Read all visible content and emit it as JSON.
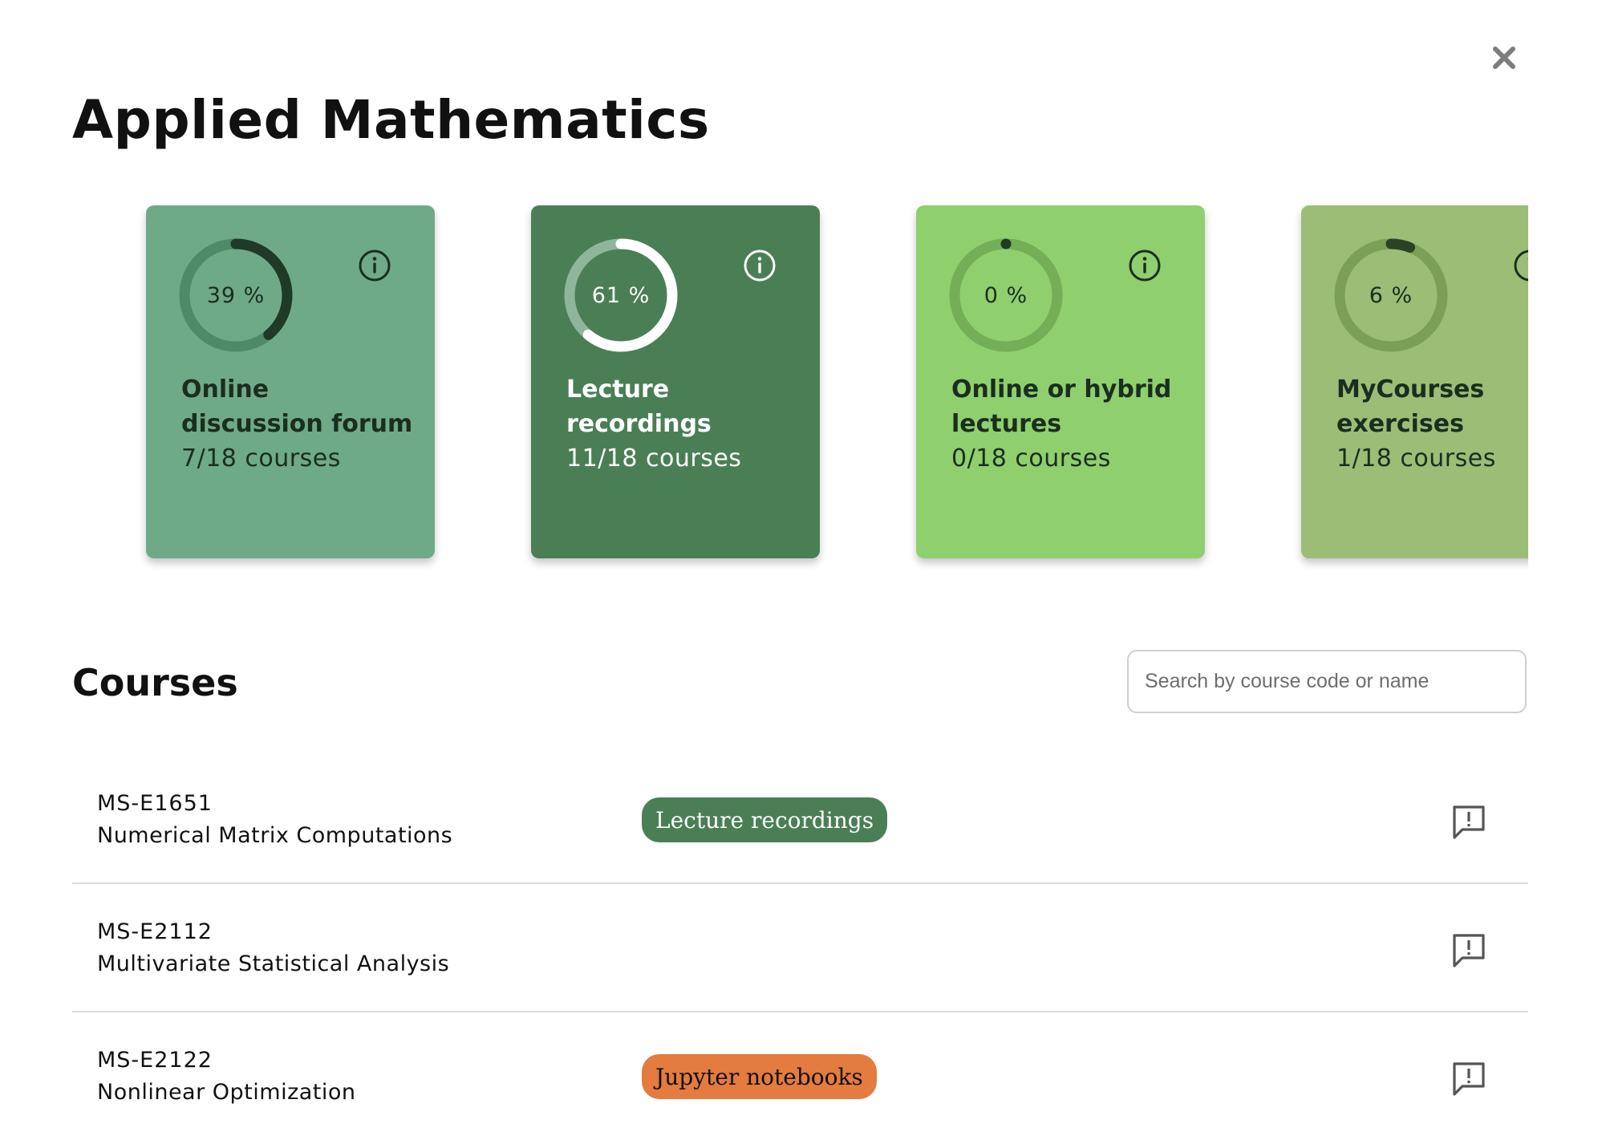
{
  "page": {
    "title": "Applied Mathematics"
  },
  "close_button": {
    "icon": "close-icon"
  },
  "stats": [
    {
      "percent_label": "39 %",
      "progress": 0.39,
      "title": "Online discussion forum",
      "count": "7/18 courses",
      "bg": "#6faa86",
      "track": "#4e8a65",
      "fill": "#1f3a26",
      "text": "#1a2e1f",
      "info_icon": "info-icon"
    },
    {
      "percent_label": "61 %",
      "progress": 0.61,
      "title": "Lecture recordings",
      "count": "11/18 courses",
      "bg": "#4a7f56",
      "track": "#8fb59a",
      "fill": "#ffffff",
      "text": "#ffffff",
      "info_icon": "info-icon"
    },
    {
      "percent_label": "0 %",
      "progress": 0.0,
      "title": "Online or hybrid lectures",
      "count": "0/18 courses",
      "bg": "#8fcf6e",
      "track": "#74ae56",
      "fill": "#1f3a26",
      "text": "#1a2e1f",
      "info_icon": "info-icon"
    },
    {
      "percent_label": "6 %",
      "progress": 0.06,
      "title": "MyCourses exercises",
      "count": "1/18 courses",
      "bg": "#9bbd76",
      "track": "#7c9f58",
      "fill": "#2b4228",
      "text": "#1a2e1f",
      "info_icon": "info-icon"
    }
  ],
  "courses_section": {
    "title": "Courses",
    "search_placeholder": "Search by course code or name"
  },
  "courses": [
    {
      "code": "MS-E1651",
      "name": "Numerical Matrix Computations",
      "tag": "Lecture recordings",
      "tag_bg": "#4a7f56",
      "tag_color": "#ffffff",
      "action_icon": "feedback-icon"
    },
    {
      "code": "MS-E2112",
      "name": "Multivariate Statistical Analysis",
      "tag": "",
      "tag_bg": "",
      "tag_color": "",
      "action_icon": "feedback-icon"
    },
    {
      "code": "MS-E2122",
      "name": "Nonlinear Optimization",
      "tag": "Jupyter notebooks",
      "tag_bg": "#e47b3f",
      "tag_color": "#111111",
      "action_icon": "feedback-icon"
    }
  ]
}
